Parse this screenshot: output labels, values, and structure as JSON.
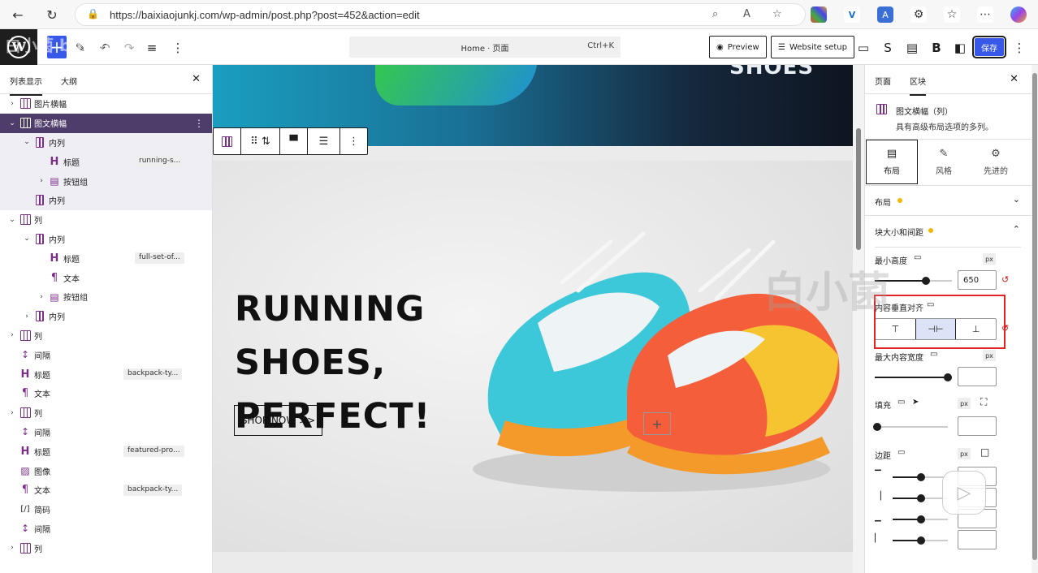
{
  "browser": {
    "url": "https://baixiaojunkj.com/wp-admin/post.php?post=452&action=edit"
  },
  "toolbar": {
    "command_title": "Home · 页面",
    "command_shortcut": "Ctrl+K",
    "preview_label": "Preview",
    "website_setup_label": "Website setup",
    "save_label": "保存"
  },
  "list_view": {
    "tab_list": "列表显示",
    "tab_outline": "大纲",
    "rows": [
      {
        "label": "图片横幅",
        "icon": "columns",
        "chev": "›",
        "depth": 0,
        "tag": ""
      },
      {
        "label": "图文横幅",
        "icon": "columns",
        "chev": "⌄",
        "depth": 0,
        "tag": "",
        "selected": true
      },
      {
        "label": "内列",
        "icon": "column",
        "chev": "⌄",
        "depth": 1,
        "tag": "",
        "sub": true
      },
      {
        "label": "标题",
        "icon": "H",
        "chev": "",
        "depth": 2,
        "tag": "running-s...",
        "sub": true
      },
      {
        "label": "按钮组",
        "icon": "buttons",
        "chev": "›",
        "depth": 2,
        "tag": "",
        "sub": true
      },
      {
        "label": "内列",
        "icon": "column",
        "chev": "",
        "depth": 1,
        "tag": "",
        "sub": true
      },
      {
        "label": "列",
        "icon": "columns",
        "chev": "⌄",
        "depth": 0,
        "tag": ""
      },
      {
        "label": "内列",
        "icon": "column",
        "chev": "⌄",
        "depth": 1,
        "tag": ""
      },
      {
        "label": "标题",
        "icon": "H",
        "chev": "",
        "depth": 2,
        "tag": "full-set-of..."
      },
      {
        "label": "文本",
        "icon": "¶",
        "chev": "",
        "depth": 2,
        "tag": ""
      },
      {
        "label": "按钮组",
        "icon": "buttons",
        "chev": "›",
        "depth": 2,
        "tag": ""
      },
      {
        "label": "内列",
        "icon": "column",
        "chev": "›",
        "depth": 1,
        "tag": ""
      },
      {
        "label": "列",
        "icon": "columns",
        "chev": "›",
        "depth": 0,
        "tag": ""
      },
      {
        "label": "间隔",
        "icon": "spacer",
        "chev": "",
        "depth": 0,
        "tag": ""
      },
      {
        "label": "标题",
        "icon": "H",
        "chev": "",
        "depth": 0,
        "tag": "backpack-ty..."
      },
      {
        "label": "文本",
        "icon": "¶",
        "chev": "",
        "depth": 0,
        "tag": ""
      },
      {
        "label": "列",
        "icon": "columns",
        "chev": "›",
        "depth": 0,
        "tag": ""
      },
      {
        "label": "间隔",
        "icon": "spacer",
        "chev": "",
        "depth": 0,
        "tag": ""
      },
      {
        "label": "标题",
        "icon": "H",
        "chev": "",
        "depth": 0,
        "tag": "featured-pro..."
      },
      {
        "label": "图像",
        "icon": "image",
        "chev": "",
        "depth": 0,
        "tag": ""
      },
      {
        "label": "文本",
        "icon": "¶",
        "chev": "",
        "depth": 0,
        "tag": "backpack-ty..."
      },
      {
        "label": "简码",
        "icon": "[/]",
        "chev": "",
        "depth": 0,
        "tag": ""
      },
      {
        "label": "间隔",
        "icon": "spacer",
        "chev": "",
        "depth": 0,
        "tag": ""
      },
      {
        "label": "列",
        "icon": "columns",
        "chev": "›",
        "depth": 0,
        "tag": ""
      }
    ]
  },
  "canvas": {
    "hero_top_text": "SHOES",
    "headline_line1": "RUNNING SHOES,",
    "headline_line2": "PERFECT!",
    "shop_button": "SHOP NOW >>"
  },
  "inspector": {
    "tab_page": "页面",
    "tab_block": "区块",
    "block_title": "图文横幅（列）",
    "block_desc": "具有高级布局选项的多列。",
    "style_tabs": [
      "布局",
      "风格",
      "先进的"
    ],
    "section_layout": "布局",
    "section_size": "块大小和间距",
    "min_height_label": "最小高度",
    "min_height_unit": "px",
    "min_height_value": "650",
    "vertical_align_label": "内容垂直对齐",
    "max_width_label": "最大内容宽度",
    "max_width_unit": "px",
    "padding_label": "填充",
    "padding_unit": "px",
    "margin_label": "边距",
    "margin_unit": "px"
  },
  "watermark": {
    "text_right": "白小菌",
    "text_left": "白小菌 bilibili"
  }
}
